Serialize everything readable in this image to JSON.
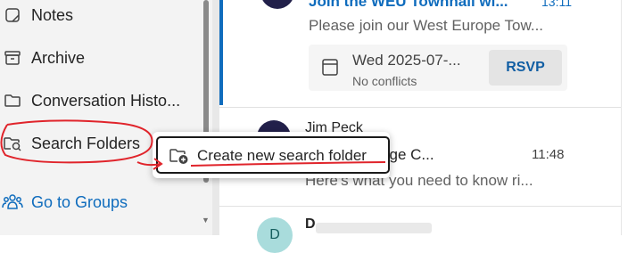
{
  "nav": {
    "items": [
      {
        "label": "Notes",
        "icon": "notes-icon"
      },
      {
        "label": "Archive",
        "icon": "archive-icon"
      },
      {
        "label": "Conversation Histo...",
        "icon": "folder-icon"
      },
      {
        "label": "Search Folders",
        "icon": "search-folder-icon"
      },
      {
        "label": "Go to Groups",
        "icon": "groups-icon"
      }
    ]
  },
  "messages": [
    {
      "subject": "Join the WEU Townhall wi...",
      "time": "13:11",
      "preview": "Please join our West Europe Tow...",
      "event": {
        "date": "Wed 2025-07-...",
        "conflicts": "No conflicts",
        "rsvp_label": "RSVP"
      }
    },
    {
      "sender": "Jim Peck",
      "subject": "...nd Exchange C...",
      "time": "11:48",
      "preview": "Here's what you need to know ri..."
    },
    {
      "avatar_initial": "D",
      "sender": "D"
    }
  ],
  "context_menu": {
    "item_label": "Create new search folder",
    "icon": "folder-add-icon"
  },
  "colors": {
    "accent": "#0f6cbd",
    "annotation": "#e0242b",
    "nav_bg": "#f3f3f3"
  }
}
